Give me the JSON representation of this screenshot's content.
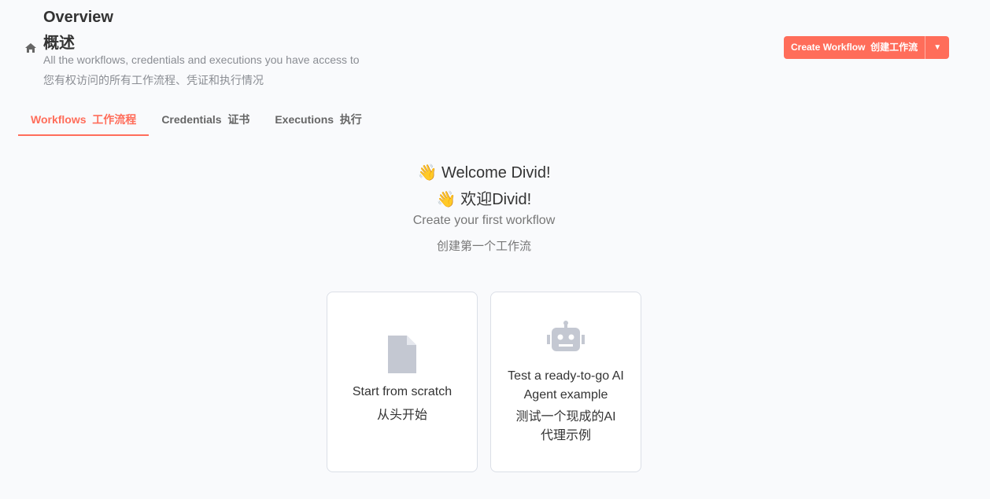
{
  "header": {
    "title": "Overview",
    "title_cn": "概述",
    "subtitle": "All the workflows, credentials and executions you have access to",
    "subtitle_cn": "您有权访问的所有工作流程、凭证和执行情况",
    "create_label": "Create Workflow  创建工作流",
    "dropdown_icon": "chevron-down-icon"
  },
  "tabs": [
    {
      "label": "Workflows  工作流程",
      "active": true
    },
    {
      "label": "Credentials  证书"
    },
    {
      "label": "Executions  执行"
    }
  ],
  "welcome": {
    "line1": "👋 Welcome Divid!",
    "line2": "👋 欢迎Divid!",
    "line3": "Create your first workflow",
    "line4": "创建第一个工作流"
  },
  "cards": [
    {
      "icon": "file-icon",
      "label": "Start from scratch",
      "label_cn": "从头开始"
    },
    {
      "icon": "robot-icon",
      "label": "Test a ready-to-go AI Agent example",
      "label_cn": "测试一个现成的AI代理示例"
    }
  ],
  "colors": {
    "accent": "#ff6d5a"
  }
}
